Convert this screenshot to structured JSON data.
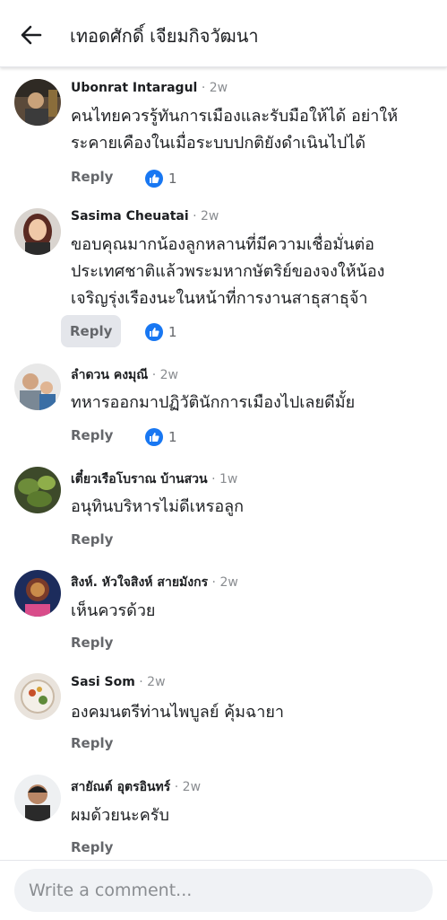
{
  "header": {
    "title": "เทอดศักดิ์ เจียมกิจวัฒนา"
  },
  "comments": [
    {
      "name": "Ubonrat Intaragul",
      "time": "· 2w",
      "text": "คนไทยควรรู้ทันการเมืองและรับมือให้ได้ อย่าให้\nระคายเคืองในเมื่อระบบปกติยังดำเนินไปได้",
      "reply": "Reply",
      "likes": "1"
    },
    {
      "name": "Sasima Cheuatai",
      "time": "· 2w",
      "text": "ขอบคุณมากน้องลูกหลานที่มีความเชื่อมั่นต่อ\nประเทศชาติแล้วพระมหากษัตริย์ของจงให้น้อง\nเจริญรุ่งเรืองนะในหน้าที่การงานสาธุสาธุจ้า",
      "reply": "Reply",
      "likes": "1"
    },
    {
      "name": "ลำดวน คงมุณี",
      "time": "· 2w",
      "text": "ทหารออกมาปฏิวัตินักการเมืองไปเลยดีมั้ย",
      "reply": "Reply",
      "likes": "1"
    },
    {
      "name": "เตี๋ยวเรือโบราณ บ้านสวน",
      "time": "· 1w",
      "text": "อนุทินบริหารไม่ดีเหรอลูก",
      "reply": "Reply"
    },
    {
      "name": "สิงห์. หัวใจสิงห์ สายมังกร",
      "time": "· 2w",
      "text": "เห็นควรด้วย",
      "reply": "Reply"
    },
    {
      "name": "Sasi Som",
      "time": "· 2w",
      "text": "องคมนตรีท่านไพบูลย์ คุ้มฉายา",
      "reply": "Reply"
    },
    {
      "name": "สายัณต์ อุตรอินทร์",
      "time": "· 2w",
      "text": "ผมด้วยนะครับ",
      "reply": "Reply"
    }
  ],
  "composer": {
    "placeholder": "Write a comment..."
  },
  "icons": {
    "back": "back-arrow-icon",
    "like": "like-thumb-icon"
  },
  "colors": {
    "like_blue": "#1877f2",
    "muted": "#65676b"
  }
}
